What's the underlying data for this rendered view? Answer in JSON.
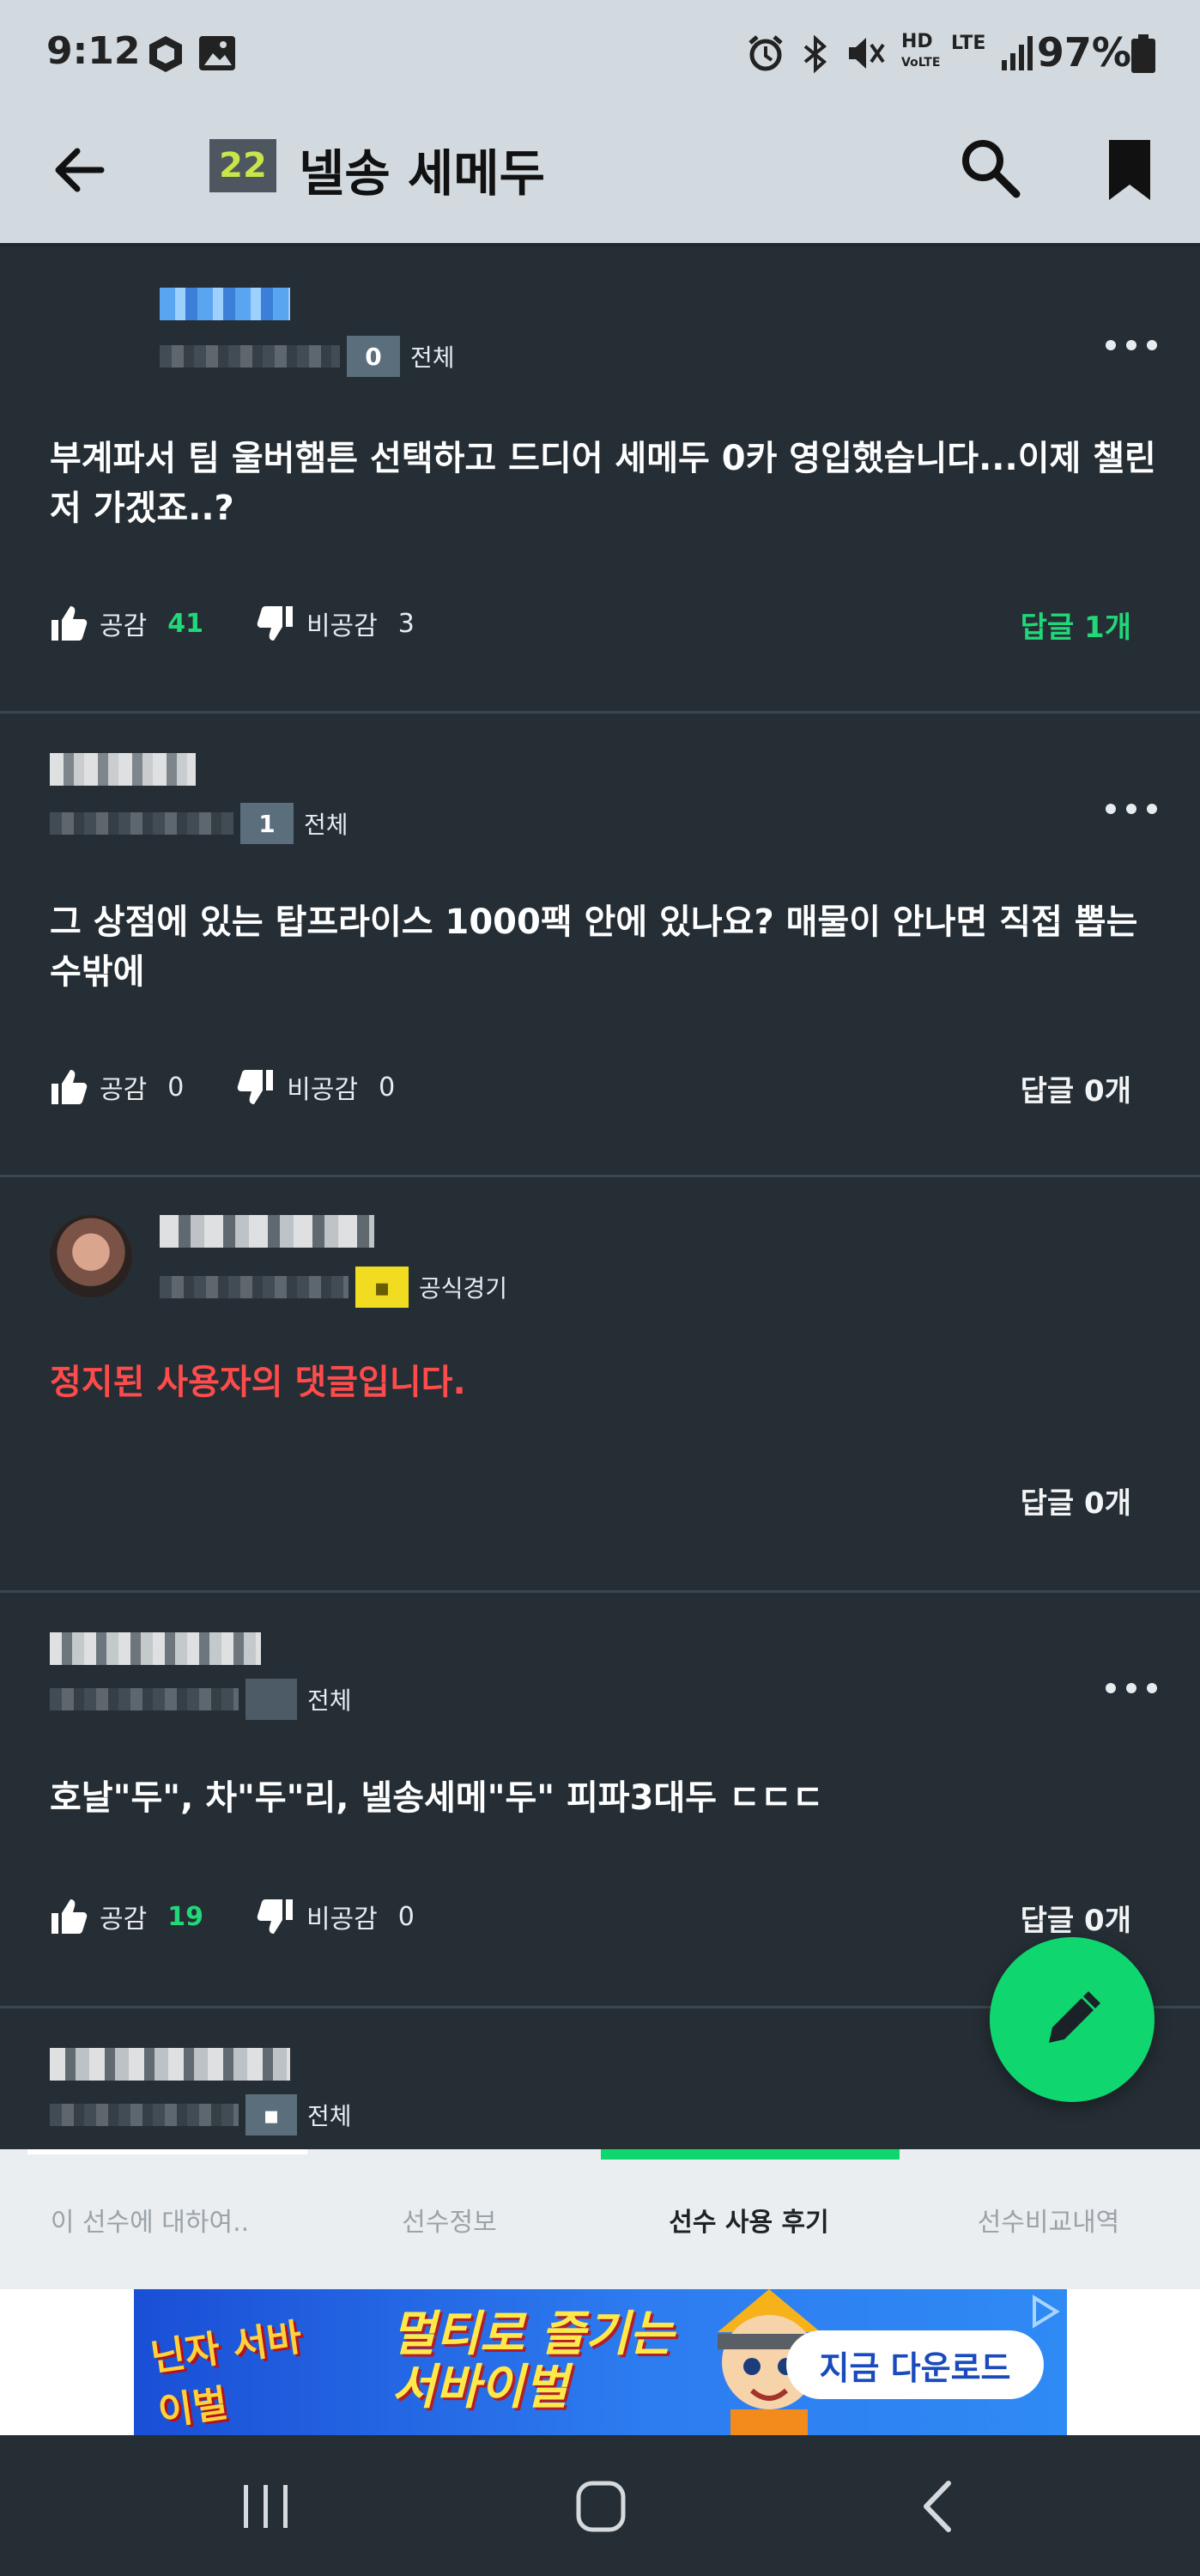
{
  "status_bar": {
    "time": "9:12",
    "battery": "97%",
    "network": "LTE",
    "hd_voice": "HD"
  },
  "app_bar": {
    "rating": "22",
    "title": "넬송 세메두"
  },
  "comments": [
    {
      "level": "0",
      "category": "전체",
      "text": "부계파서 팀 울버햄튼 선택하고 드디어 세메두 0카 영입했습니다...이제 챌린저 가겠죠..?",
      "like_label": "공감",
      "like_count": "41",
      "dislike_label": "비공감",
      "dislike_count": "3",
      "replies": "답글 1개"
    },
    {
      "level": "1",
      "category": "전체",
      "text": "그 상점에 있는 탑프라이스 1000팩 안에 있나요? 매물이 안나면 직접 뽑는수밖에",
      "like_label": "공감",
      "like_count": "0",
      "dislike_label": "비공감",
      "dislike_count": "0",
      "replies": "답글 0개"
    },
    {
      "category": "공식경기",
      "text": "정지된 사용자의 댓글입니다.",
      "replies": "답글 0개"
    },
    {
      "category": "전체",
      "text": "호날\"두\", 차\"두\"리, 넬송세메\"두\" 피파3대두 ㄷㄷㄷ",
      "like_label": "공감",
      "like_count": "19",
      "dislike_label": "비공감",
      "dislike_count": "0",
      "replies": "답글 0개"
    },
    {
      "category": "전체"
    }
  ],
  "tabs": [
    {
      "label": "이 선수에 대하여.."
    },
    {
      "label": "선수정보"
    },
    {
      "label": "선수 사용 후기",
      "active": true
    },
    {
      "label": "선수비교내역"
    }
  ],
  "ad": {
    "game_name": "닌자 서바이벌",
    "slogan_line1": "멀티로 즐기는",
    "slogan_line2": "서바이벌",
    "cta": "지금 다운로드"
  },
  "colors": {
    "background": "#252e35",
    "accent_green": "#10d66f",
    "deleted_red": "#ff4b4b",
    "appbar": "#d3dadf"
  }
}
